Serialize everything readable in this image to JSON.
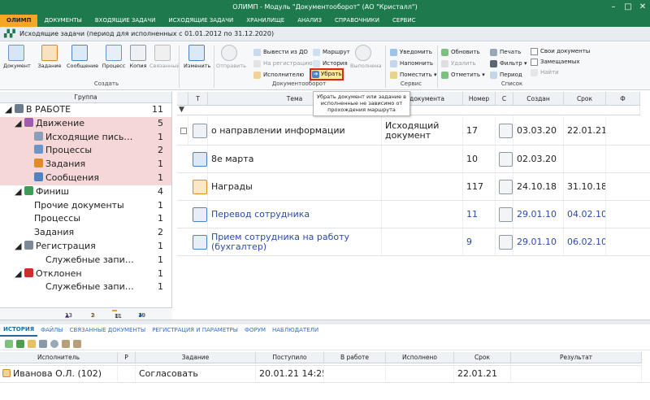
{
  "window": {
    "title": "ОЛИМП - Модуль \"Документооборот\" (АО \"Кристалл\")",
    "minimize": "–",
    "maximize": "□",
    "close": "✕"
  },
  "menu": [
    "ОЛИМП",
    "ДОКУМЕНТЫ",
    "ВХОДЯЩИЕ ЗАДАЧИ",
    "ИСХОДЯЩИЕ ЗАДАЧИ",
    "ХРАНИЛИЩЕ",
    "АНАЛИЗ",
    "СПРАВОЧНИКИ",
    "СЕРВИС"
  ],
  "doc_title": "Исходящие задачи (период для исполненных с 01.01.2012 по 31.12.2020)",
  "ribbon": {
    "create": {
      "group": "Создать",
      "document": "Документ",
      "task": "Задание",
      "message": "Сообщение",
      "process": "Процесс",
      "copy": "Копия",
      "linked": "Связанный",
      "edit": "Изменить"
    },
    "workflow": {
      "group": "Документооборот",
      "send": "Отправить",
      "withdraw_to": "Вывести из ДО",
      "to_registration": "На регистрацию",
      "to_executor": "Исполнителю",
      "route": "Маршрут",
      "history": "История",
      "remove": "Убрать",
      "executed": "Выполнена"
    },
    "service": {
      "group": "Сервис",
      "notify": "Уведомить",
      "remind": "Напомнить",
      "place": "Поместить"
    },
    "list": {
      "group": "Список",
      "refresh": "Обновить",
      "delete": "Удалить",
      "mark": "Отметить",
      "print": "Печать",
      "filter": "Фильтр",
      "period": "Период",
      "own_docs": "Свои документы",
      "notes": "Замещаемых",
      "find": "Найти"
    }
  },
  "tooltip": "Убрать документ или задание в исполненные не зависимо от прохождения маршрута",
  "left_panel": {
    "header": "Группа",
    "tree": [
      {
        "label": "В РАБОТЕ",
        "count": "11"
      },
      {
        "label": "Движение",
        "count": "5"
      },
      {
        "label": "Исходящие письма",
        "display": "Исходящие пись…",
        "count": "1"
      },
      {
        "label": "Процессы",
        "count": "2"
      },
      {
        "label": "Задания",
        "count": "1"
      },
      {
        "label": "Сообщения",
        "count": "1"
      },
      {
        "label": "Финиш",
        "count": "4"
      },
      {
        "label": "Прочие документы",
        "count": "1"
      },
      {
        "label": "Процессы",
        "count": "1"
      },
      {
        "label": "Задания",
        "count": "2"
      },
      {
        "label": "Регистрация",
        "count": "1"
      },
      {
        "label": "Служебные записки",
        "display": "Служебные запи…",
        "count": "1"
      },
      {
        "label": "Отклонен",
        "count": "1"
      },
      {
        "label": "Служебные записки",
        "display": "Служебные запи…",
        "count": "1"
      }
    ],
    "footer_counts": [
      "13",
      "2",
      "11",
      "19"
    ]
  },
  "grid": {
    "headers": {
      "t": "Т",
      "subject": "Тема",
      "doc_type": "ип документа",
      "number": "Номер",
      "s": "С",
      "created": "Создан",
      "deadline": "Срок",
      "f": "Ф"
    },
    "rows": [
      {
        "subject": "о направлении информации",
        "doc_type": "Исходящий документ",
        "number": "17",
        "created": "03.03.20",
        "deadline": "22.01.21"
      },
      {
        "subject": "8е марта",
        "doc_type": "",
        "number": "10",
        "created": "02.03.20",
        "deadline": ""
      },
      {
        "subject": "Награды",
        "doc_type": "",
        "number": "117",
        "created": "24.10.18",
        "deadline": "31.10.18"
      },
      {
        "subject": "Перевод сотрудника",
        "doc_type": "",
        "number": "11",
        "created": "29.01.10",
        "deadline": "04.02.10"
      },
      {
        "subject": "Прием сотрудника на работу (бухгалтер)",
        "doc_type": "",
        "number": "9",
        "created": "29.01.10",
        "deadline": "06.02.10"
      }
    ]
  },
  "bottom": {
    "tabs": [
      "ИСТОРИЯ",
      "ФАЙЛЫ",
      "СВЯЗАННЫЕ ДОКУМЕНТЫ",
      "РЕГИСТРАЦИЯ И ПАРАМЕТРЫ",
      "ФОРУМ",
      "НАБЛЮДАТЕЛИ"
    ],
    "headers": {
      "executor": "Исполнитель",
      "p": "Р",
      "task": "Задание",
      "received": "Поступило",
      "in_work": "В работе",
      "done": "Исполнено",
      "deadline": "Срок",
      "result": "Результат"
    },
    "row": {
      "executor": "Иванова О.Л. (102)",
      "task": "Согласовать",
      "received": "20.01.21 14:25",
      "deadline": "22.01.21"
    }
  }
}
